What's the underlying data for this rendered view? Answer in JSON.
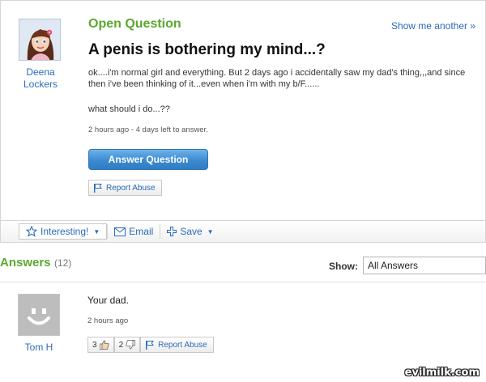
{
  "question": {
    "kind": "Open Question",
    "show_another": "Show me another »",
    "asker_name": "Deena Lockers",
    "title": "A penis is bothering my mind...?",
    "body": "ok....i'm normal girl and everything. But 2 days ago i accidentally saw my dad's thing,,,and since then i've been thinking of it...even when i'm with my b/F......",
    "followup": "what should i do...??",
    "meta": "2 hours ago - 4 days left to answer.",
    "answer_button": "Answer Question",
    "report_abuse": "Report Abuse"
  },
  "actions": {
    "interesting": "Interesting!",
    "email": "Email",
    "save": "Save"
  },
  "answers": {
    "title": "Answers",
    "count": "(12)",
    "show_label": "Show:",
    "show_value": "All Answers",
    "items": [
      {
        "user": "Tom H",
        "text": "Your dad.",
        "meta": "2 hours ago",
        "thumbs_up": "3",
        "thumbs_down": "2",
        "report_abuse": "Report Abuse"
      }
    ]
  },
  "watermark": "evilmilk.com",
  "icons": [
    "star-icon",
    "envelope-icon",
    "plus-icon",
    "flag-icon",
    "thumbs-up-icon",
    "thumbs-down-icon",
    "chevron-down-icon"
  ],
  "colors": {
    "accent_green": "#5aa82e",
    "link_blue": "#2a6cb8",
    "button_blue": "#3c8bd1"
  }
}
